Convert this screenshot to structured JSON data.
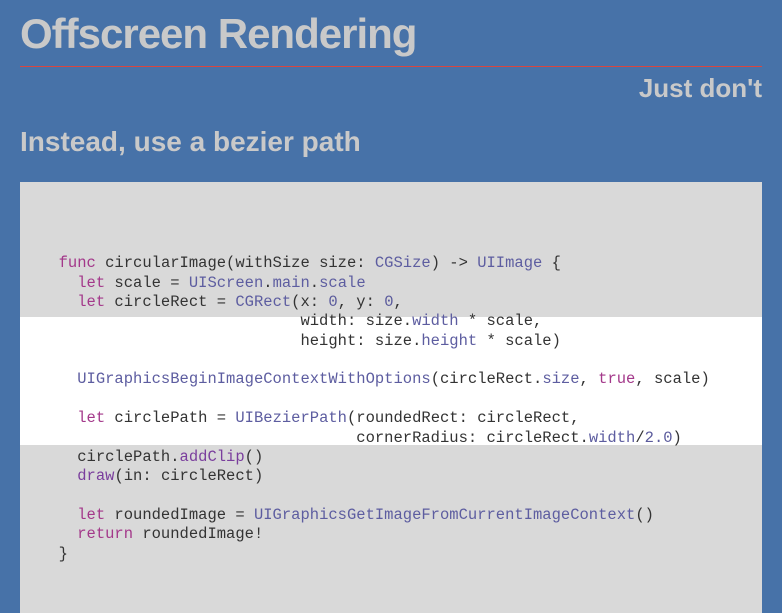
{
  "title": "Offscreen Rendering",
  "subtitle": "Just don't",
  "heading": "Instead, use a bezier path",
  "code": {
    "l1a": "func",
    "l1b": " circularImage(withSize size: ",
    "l1c": "CGSize",
    "l1d": ") -> ",
    "l1e": "UIImage",
    "l1f": " {",
    "l2a": "let",
    "l2b": " scale = ",
    "l2c": "UIScreen",
    "l2d": ".",
    "l2e": "main",
    "l2f": ".",
    "l2g": "scale",
    "l3a": "let",
    "l3b": " circleRect = ",
    "l3c": "CGRect",
    "l3d": "(x: ",
    "l3e": "0",
    "l3f": ", y: ",
    "l3g": "0",
    "l3h": ",",
    "l4a": "width: size.",
    "l4b": "width",
    "l4c": " * scale,",
    "l5a": "height: size.",
    "l5b": "height",
    "l5c": " * scale)",
    "l6a": "UIGraphicsBeginImageContextWithOptions",
    "l6b": "(circleRect.",
    "l6c": "size",
    "l6d": ", ",
    "l6e": "true",
    "l6f": ", scale)",
    "l7a": "let",
    "l7b": " circlePath = ",
    "l7c": "UIBezierPath",
    "l7d": "(roundedRect: circleRect,",
    "l8a": "cornerRadius: circleRect.",
    "l8b": "width",
    "l8c": "/",
    "l8d": "2.0",
    "l8e": ")",
    "l9a": "circlePath.",
    "l9b": "addClip",
    "l9c": "()",
    "l10a": "draw",
    "l10b": "(in: circleRect)",
    "l11a": "let",
    "l11b": " roundedImage = ",
    "l11c": "UIGraphicsGetImageFromCurrentImageContext",
    "l11d": "()",
    "l12a": "return",
    "l12b": " roundedImage!",
    "l13": "}"
  }
}
